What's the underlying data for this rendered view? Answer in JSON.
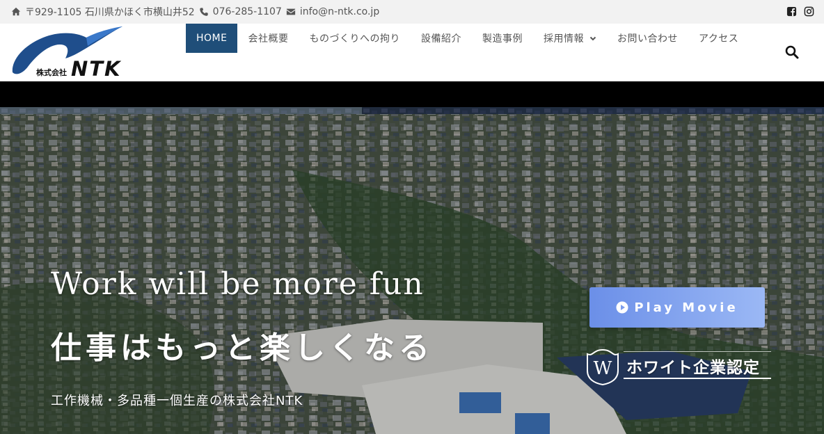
{
  "topbar": {
    "address": "〒929-1105 石川県かほく市横山井52",
    "phone": "076-285-1107",
    "email": "info@n-ntk.co.jp"
  },
  "logo": {
    "company_prefix": "株式会社",
    "company_name": "NTK"
  },
  "nav": {
    "items": [
      {
        "label": "HOME",
        "active": true
      },
      {
        "label": "会社概要"
      },
      {
        "label": "ものづくりへの拘り"
      },
      {
        "label": "設備紹介"
      },
      {
        "label": "製造事例"
      },
      {
        "label": "採用情報",
        "has_dropdown": true
      },
      {
        "label": "お問い合わせ"
      },
      {
        "label": "アクセス"
      }
    ]
  },
  "hero": {
    "title_en": "Work will be more fun",
    "title_jp": "仕事はもっと楽しくなる",
    "subtitle": "工作機械・多品種一個生産の株式会社NTK",
    "play_label": "Play Movie",
    "badge_label": "ホワイト企業認定",
    "badge_letter": "W"
  },
  "colors": {
    "nav_active": "#1f4e79",
    "play_button_start": "#6b8fe8",
    "play_button_end": "#9bb8f5",
    "logo_blue": "#1f4e8c"
  },
  "icons": [
    "home-icon",
    "phone-icon",
    "envelope-icon",
    "facebook-icon",
    "instagram-icon",
    "search-icon",
    "play-circle-icon",
    "chevron-down-icon"
  ]
}
